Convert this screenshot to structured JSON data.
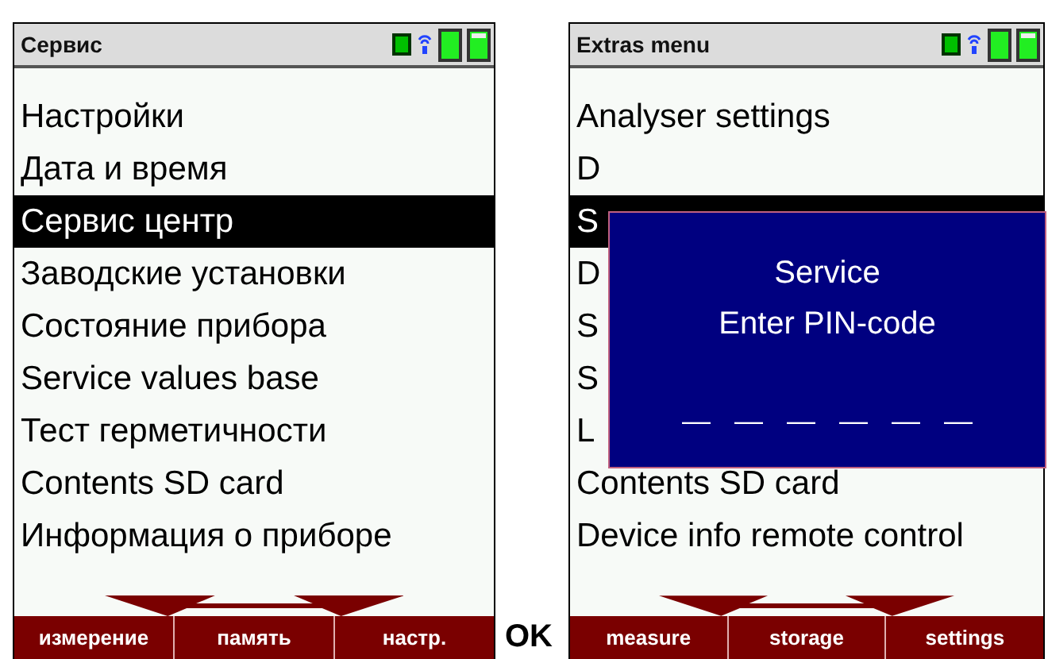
{
  "screens": [
    {
      "title": "Сервис",
      "menu": [
        {
          "label": "Настройки",
          "selected": false
        },
        {
          "label": "Дата и время",
          "selected": false
        },
        {
          "label": "Сервис центр",
          "selected": true
        },
        {
          "label": "Заводские установки",
          "selected": false
        },
        {
          "label": "Состояние прибора",
          "selected": false
        },
        {
          "label": "Service values base",
          "selected": false
        },
        {
          "label": "Тест герметичности",
          "selected": false
        },
        {
          "label": "Contents SD card",
          "selected": false
        },
        {
          "label": "Информация о приборе",
          "selected": false
        }
      ],
      "softkeys": [
        "измерение",
        "память",
        "настр."
      ]
    },
    {
      "title": "Extras menu",
      "menu": [
        {
          "label": "Analyser settings",
          "selected": false
        },
        {
          "label": "D",
          "selected": false
        },
        {
          "label": "S",
          "selected": true
        },
        {
          "label": "D",
          "selected": false
        },
        {
          "label": "S",
          "selected": false
        },
        {
          "label": "S",
          "selected": false
        },
        {
          "label": "L",
          "selected": false
        },
        {
          "label": "Contents SD card",
          "selected": false
        },
        {
          "label": "Device info remote control",
          "selected": false
        }
      ],
      "softkeys": [
        "measure",
        "storage",
        "settings"
      ],
      "dialog": {
        "title": "Service",
        "message": "Enter PIN-code",
        "pin_mask": "—   —   —   —   —   —"
      }
    }
  ],
  "key_label": "OK"
}
